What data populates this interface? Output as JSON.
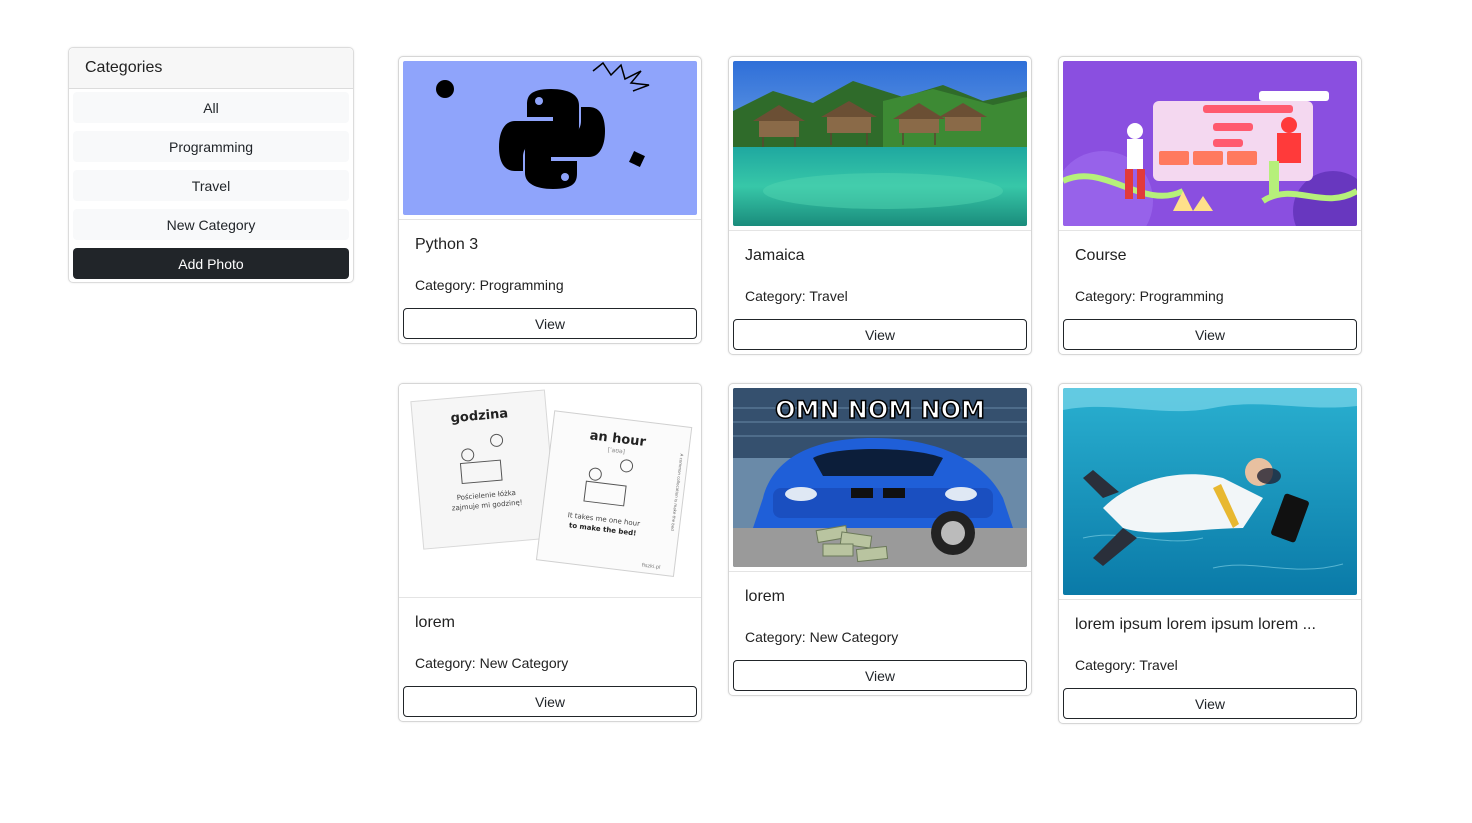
{
  "sidebar": {
    "title": "Categories",
    "categories": [
      "All",
      "Programming",
      "Travel",
      "New Category"
    ],
    "add_label": "Add Photo"
  },
  "cards": [
    {
      "title": "Python 3",
      "category": "Category: Programming",
      "view_label": "View",
      "image": "python-logo"
    },
    {
      "title": "Jamaica",
      "category": "Category: Travel",
      "view_label": "View",
      "image": "tropical-bungalows"
    },
    {
      "title": "Course",
      "category": "Category: Programming",
      "view_label": "View",
      "image": "web-course-illustration"
    },
    {
      "title": "lorem",
      "category": "Category: New Category",
      "view_label": "View",
      "image": "flashcards",
      "flashcard_text": {
        "left_word": "godzina",
        "left_sentence_1": "Pościelenie łóżka",
        "left_sentence_2": "zajmuje mi godzinę!",
        "right_word": "an hour",
        "right_phonetic": "[ˈaʊə]",
        "right_sentence_1": "It takes me one hour",
        "right_sentence_2": "to make the bed!",
        "right_side_note": "A common collocation is make the bed",
        "brand": "fiszki.pl"
      }
    },
    {
      "title": "lorem",
      "category": "Category: New Category",
      "view_label": "View",
      "image": "blue-car-meme",
      "meme_caption": "OMN NOM NOM"
    },
    {
      "title": "lorem ipsum lorem ipsum lorem ...",
      "category": "Category: Travel",
      "view_label": "View",
      "image": "underwater-businessman"
    }
  ],
  "colors": {
    "dark_button": "#212529",
    "python_bg": "#8fa4fb"
  }
}
